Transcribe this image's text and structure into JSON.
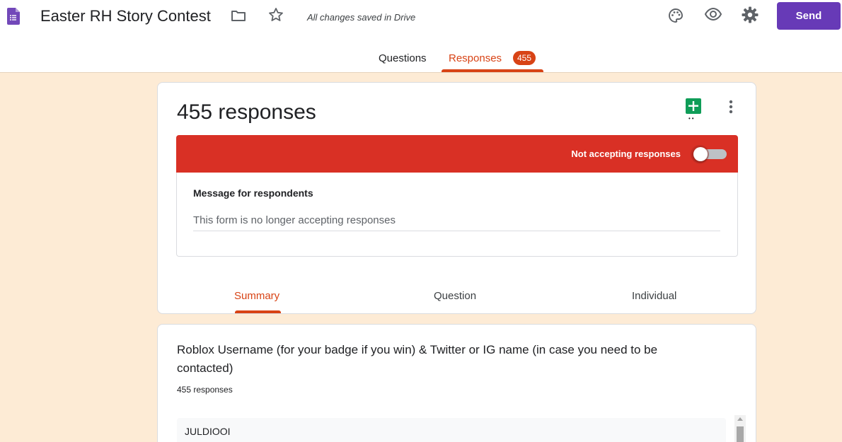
{
  "header": {
    "title": "Easter RH Story Contest",
    "saved_status": "All changes saved in Drive",
    "send_label": "Send",
    "icons": [
      "forms-logo-icon",
      "folder-icon",
      "star-icon",
      "palette-icon",
      "eye-icon",
      "gear-icon"
    ],
    "accent_color": "#673ab7"
  },
  "tabs": {
    "questions": "Questions",
    "responses": "Responses",
    "responses_count": "455",
    "active": "Responses",
    "active_color": "#d84315"
  },
  "responses_card": {
    "count_label": "455 responses",
    "banner_text": "Not accepting responses",
    "banner_color": "#d93025",
    "accepting": false,
    "message_label": "Message for respondents",
    "message_value": "This form is no longer accepting responses",
    "subtabs": [
      "Summary",
      "Question",
      "Individual"
    ],
    "active_subtab": "Summary"
  },
  "question_card": {
    "title": "Roblox Username (for your badge if you win) & Twitter or IG name (in case you need to be contacted)",
    "count": "455 responses",
    "answers": [
      "JULDIOOI"
    ]
  },
  "page_bg": "#fdebd5"
}
